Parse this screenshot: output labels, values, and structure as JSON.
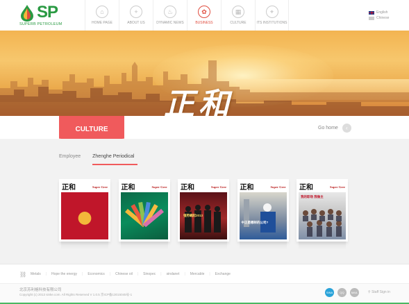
{
  "brand": {
    "name": "SP",
    "subtitle": "SUPERB PETROLEUM",
    "colors": {
      "green": "#2a9a43",
      "red": "#f05a5c",
      "orange": "#f3a23a"
    }
  },
  "nav": {
    "items": [
      {
        "label": "HOME PAGE",
        "icon": "home-icon",
        "glyph": "⌂"
      },
      {
        "label": "ABOUT US",
        "icon": "plus-icon",
        "glyph": "+"
      },
      {
        "label": "DYNAMIC NEWS",
        "icon": "drop-icon",
        "glyph": "♨"
      },
      {
        "label": "BUSINESS",
        "icon": "culture-icon",
        "glyph": "✿",
        "active": true
      },
      {
        "label": "CULTURE",
        "icon": "grid-icon",
        "glyph": "▦"
      },
      {
        "label": "ITS INSTITUTIONS",
        "icon": "map-pin-icon",
        "glyph": "⌖"
      },
      {
        "label": "CONTACT US",
        "icon": "",
        "glyph": ""
      }
    ]
  },
  "lang": {
    "english": "English",
    "chinese": "Chinese"
  },
  "banner": {
    "title": "正和"
  },
  "section": {
    "title": "CULTURE",
    "go_home": "Go home"
  },
  "tabs": [
    {
      "label": "Employee",
      "active": false
    },
    {
      "label": "Zhenghe Periodical",
      "active": true
    }
  ],
  "covers": [
    {
      "title": "正和",
      "sub": "Super Gree",
      "style": "c1",
      "caption": ""
    },
    {
      "title": "正和",
      "sub": "Super Gree",
      "style": "c2",
      "caption": ""
    },
    {
      "title": "正和",
      "sub": "Super Gree",
      "style": "c3",
      "caption": "强势崛起2013"
    },
    {
      "title": "正和",
      "sub": "Super Gree",
      "style": "c4",
      "caption": "中正是哪样的公司?"
    },
    {
      "title": "正和",
      "sub": "Super Gree",
      "style": "c5",
      "caption": "我的职场 我做主"
    }
  ],
  "footer_links": [
    "Metals",
    "Hope the energy",
    "Economics",
    "Chinese oil",
    "Sinopec",
    "sindanet",
    "Mercable",
    "Exchange"
  ],
  "footer": {
    "company": "北京苏利格科技有限公司",
    "copyright": "Copyright (c) 2013 sinke.com. All Rights Reserved V 1.0.5 京ICP备13015045号-1",
    "social": [
      "SINA",
      "QQ",
      "MAIL"
    ],
    "staff": "Staff Sign in"
  }
}
